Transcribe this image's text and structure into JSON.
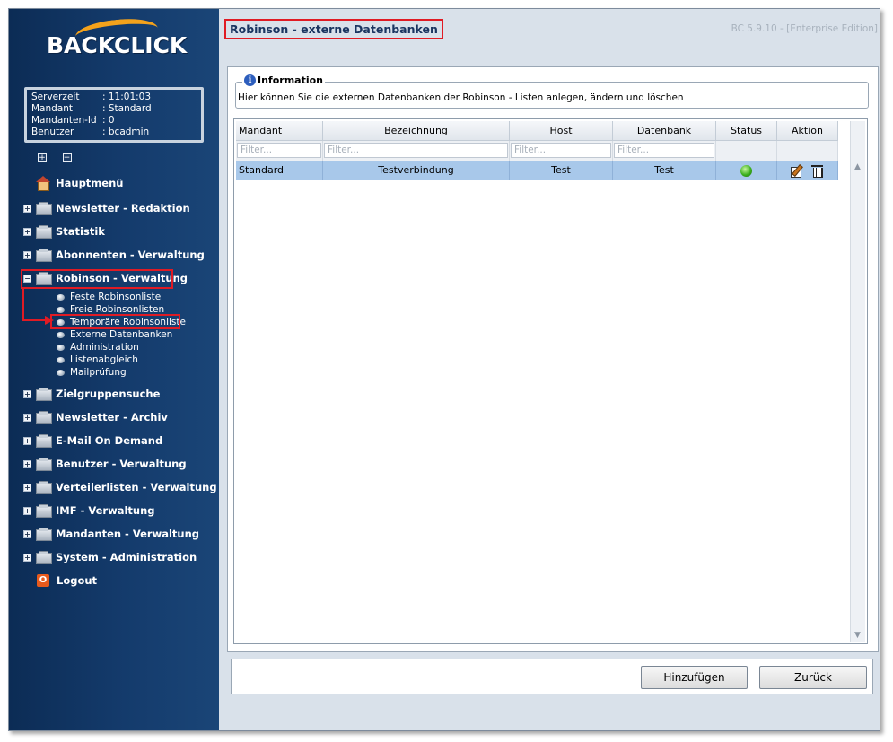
{
  "logo_text": "BACKCLICK",
  "server_info": [
    {
      "label": "Serverzeit",
      "value": ": 11:01:03"
    },
    {
      "label": "Mandant",
      "value": ": Standard"
    },
    {
      "label": "Mandanten-Id",
      "value": ": 0"
    },
    {
      "label": "Benutzer",
      "value": ": bcadmin"
    }
  ],
  "tree_tools": {
    "expand": "+",
    "collapse": "−"
  },
  "nav": {
    "hauptmenu": "Hauptmenü",
    "newsletter_redaktion": "Newsletter - Redaktion",
    "statistik": "Statistik",
    "abonnenten": "Abonnenten - Verwaltung",
    "robinson": "Robinson - Verwaltung",
    "robinson_sub": [
      "Feste Robinsonliste",
      "Freie Robinsonlisten",
      "Temporäre Robinsonliste",
      "Externe Datenbanken",
      "Administration",
      "Listenabgleich",
      "Mailprüfung"
    ],
    "zielgruppensuche": "Zielgruppensuche",
    "newsletter_archiv": "Newsletter - Archiv",
    "email_on_demand": "E-Mail On Demand",
    "benutzer": "Benutzer - Verwaltung",
    "verteilerlisten": "Verteilerlisten - Verwaltung",
    "imf": "IMF - Verwaltung",
    "mandanten": "Mandanten - Verwaltung",
    "system": "System - Administration",
    "logout": "Logout",
    "expand_symbol": "+",
    "collapse_symbol": "−",
    "logout_symbol": "O"
  },
  "header": {
    "title": "Robinson - externe Datenbanken",
    "version": "BC 5.9.10 - [Enterprise Edition]"
  },
  "information": {
    "legend": "Information",
    "icon": "i",
    "text": "Hier können Sie die externen Datenbanken der Robinson - Listen anlegen, ändern und löschen"
  },
  "table": {
    "columns": [
      "Mandant",
      "Bezeichnung",
      "Host",
      "Datenbank",
      "Status",
      "Aktion"
    ],
    "filter_placeholder": "Filter...",
    "rows": [
      {
        "mandant": "Standard",
        "bezeichnung": "Testverbindung",
        "host": "Test",
        "datenbank": "Test",
        "status": "active"
      }
    ],
    "scroll_up": "▲",
    "scroll_down": "▼"
  },
  "buttons": {
    "add": "Hinzufügen",
    "back": "Zurück"
  },
  "colors": {
    "sidebar": "#143b6c",
    "highlight": "#e01b24",
    "selected_row": "#a8c8ea",
    "status_ok": "#3cb01e"
  }
}
